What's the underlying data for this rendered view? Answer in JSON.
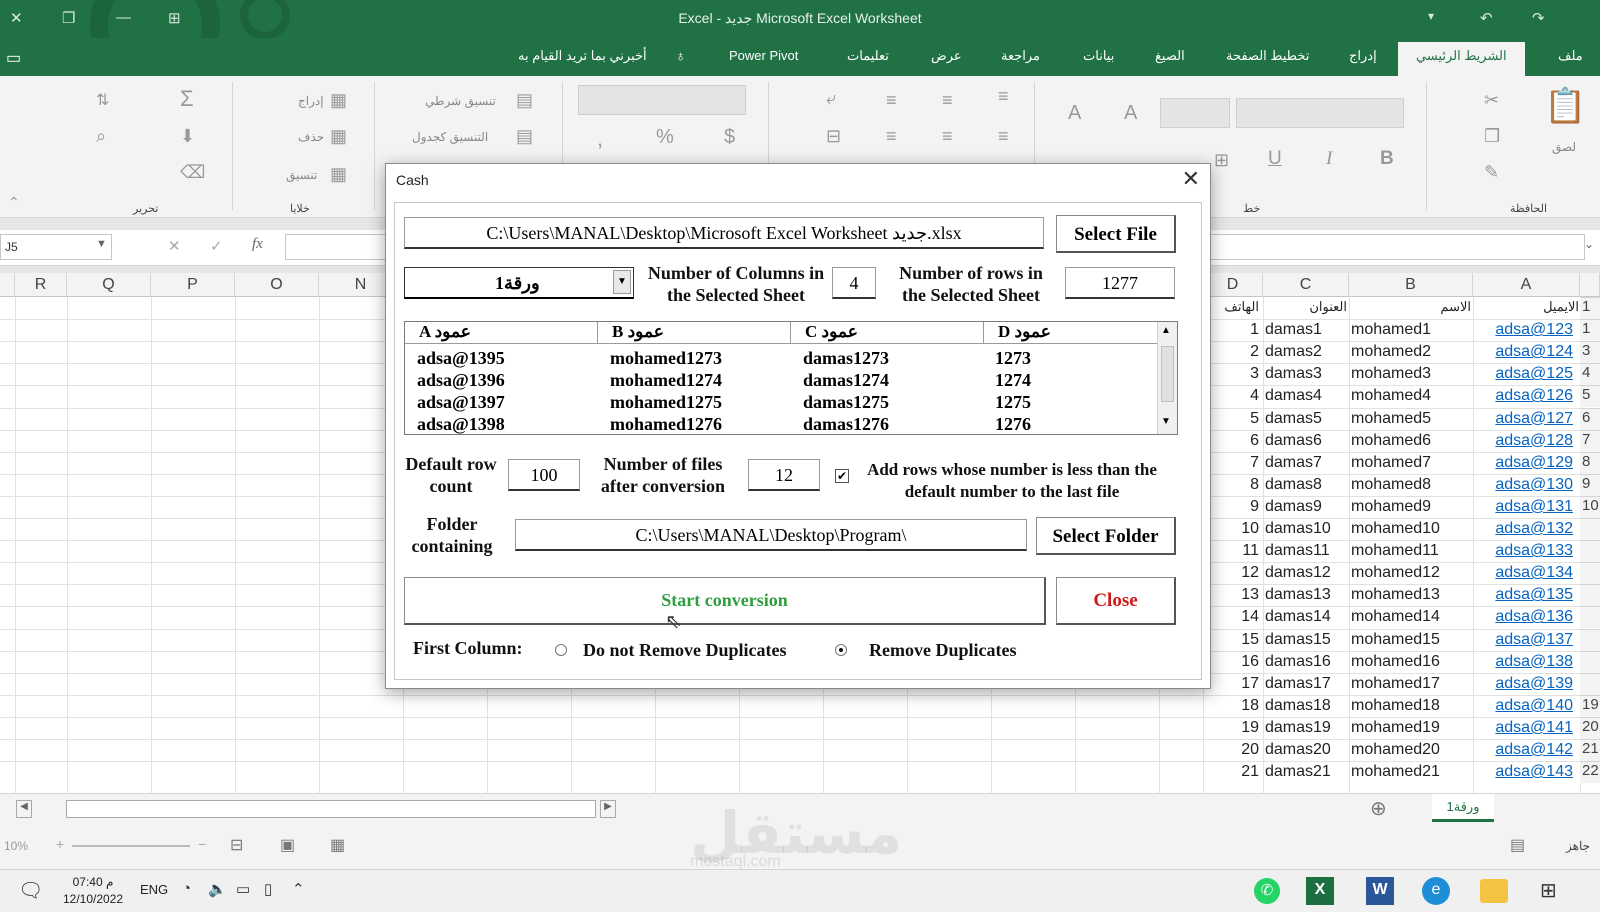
{
  "window": {
    "title": "Excel  -  جديد Microsoft Excel Worksheet"
  },
  "ribbon_tabs": [
    "ملف",
    "الشريط الرئيسي",
    "إدراج",
    "تخطيط الصفحة",
    "الصيغ",
    "بيانات",
    "مراجعة",
    "عرض",
    "تعليمات",
    "Power Pivot"
  ],
  "tell_me": "أخبرني بما تريد القيام به",
  "ribbon": {
    "groups": {
      "clipboard": "الحافظة",
      "font": "خط",
      "cells": "خلايا",
      "editing": "تحرير"
    },
    "cells_items": {
      "insert": "إدراج",
      "delete": "حذف",
      "format": "تنسيق"
    },
    "styles_items": {
      "conditional": "تنسيق شرطي",
      "as_table": "التنسيق كجدول"
    },
    "paste_label": "لصق",
    "number_symbols": {
      "currency": "$",
      "percent": "%",
      "comma": ","
    }
  },
  "formula_bar": {
    "name_box": "J5",
    "fx": "fx"
  },
  "sheet": {
    "left_columns": [
      "R",
      "Q",
      "P",
      "O",
      "N"
    ],
    "right_columns": [
      "D",
      "C",
      "B",
      "A"
    ],
    "headers": {
      "d": "الهاتف",
      "c": "العنوان",
      "b": "الاسم",
      "a": "الايميل"
    },
    "rows": [
      {
        "n": "1",
        "d": "1",
        "c": "damas1",
        "b": "mohamed1",
        "a": "adsa@123"
      },
      {
        "n": "3",
        "d": "2",
        "c": "damas2",
        "b": "mohamed2",
        "a": "adsa@124"
      },
      {
        "n": "4",
        "d": "3",
        "c": "damas3",
        "b": "mohamed3",
        "a": "adsa@125"
      },
      {
        "n": "5",
        "d": "4",
        "c": "damas4",
        "b": "mohamed4",
        "a": "adsa@126"
      },
      {
        "n": "6",
        "d": "5",
        "c": "damas5",
        "b": "mohamed5",
        "a": "adsa@127"
      },
      {
        "n": "7",
        "d": "6",
        "c": "damas6",
        "b": "mohamed6",
        "a": "adsa@128"
      },
      {
        "n": "8",
        "d": "7",
        "c": "damas7",
        "b": "mohamed7",
        "a": "adsa@129"
      },
      {
        "n": "9",
        "d": "8",
        "c": "damas8",
        "b": "mohamed8",
        "a": "adsa@130"
      },
      {
        "n": "10",
        "d": "9",
        "c": "damas9",
        "b": "mohamed9",
        "a": "adsa@131"
      },
      {
        "n": "",
        "d": "10",
        "c": "damas10",
        "b": "mohamed10",
        "a": "adsa@132"
      },
      {
        "n": "",
        "d": "11",
        "c": "damas11",
        "b": "mohamed11",
        "a": "adsa@133"
      },
      {
        "n": "",
        "d": "12",
        "c": "damas12",
        "b": "mohamed12",
        "a": "adsa@134"
      },
      {
        "n": "",
        "d": "13",
        "c": "damas13",
        "b": "mohamed13",
        "a": "adsa@135"
      },
      {
        "n": "",
        "d": "14",
        "c": "damas14",
        "b": "mohamed14",
        "a": "adsa@136"
      },
      {
        "n": "",
        "d": "15",
        "c": "damas15",
        "b": "mohamed15",
        "a": "adsa@137"
      },
      {
        "n": "",
        "d": "16",
        "c": "damas16",
        "b": "mohamed16",
        "a": "adsa@138"
      },
      {
        "n": "",
        "d": "17",
        "c": "damas17",
        "b": "mohamed17",
        "a": "adsa@139"
      },
      {
        "n": "19",
        "d": "18",
        "c": "damas18",
        "b": "mohamed18",
        "a": "adsa@140"
      },
      {
        "n": "20",
        "d": "19",
        "c": "damas19",
        "b": "mohamed19",
        "a": "adsa@141"
      },
      {
        "n": "21",
        "d": "20",
        "c": "damas20",
        "b": "mohamed20",
        "a": "adsa@142"
      },
      {
        "n": "22",
        "d": "21",
        "c": "damas21",
        "b": "mohamed21",
        "a": "adsa@143"
      }
    ],
    "sheet_tab": "ورقة1"
  },
  "status": {
    "ready": "جاهز",
    "zoom": "10%"
  },
  "taskbar": {
    "time": "07:40 م",
    "date": "12/10/2022",
    "lang": "ENG"
  },
  "watermark": {
    "text": "مستقل",
    "sub": "mostaql.com"
  },
  "dialog": {
    "title": "Cash",
    "file_path": "C:\\Users\\MANAL\\Desktop\\Microsoft Excel Worksheet جديد.xlsx",
    "select_file": "Select File",
    "sheet_select": "ورقة1",
    "num_columns_label": "Number of Columns in the Selected Sheet",
    "num_columns_value": "4",
    "num_rows_label": "Number of rows in the Selected Sheet",
    "num_rows_value": "1277",
    "list": {
      "headers": [
        "A عمود",
        "B عمود",
        "C عمود",
        "D عمود"
      ],
      "rows": [
        [
          "adsa@1395",
          "mohamed1273",
          "damas1273",
          "1273"
        ],
        [
          "adsa@1396",
          "mohamed1274",
          "damas1274",
          "1274"
        ],
        [
          "adsa@1397",
          "mohamed1275",
          "damas1275",
          "1275"
        ],
        [
          "adsa@1398",
          "mohamed1276",
          "damas1276",
          "1276"
        ]
      ]
    },
    "default_row_label": "Default row count",
    "default_row_value": "100",
    "files_after_label": "Number of files after conversion",
    "files_after_value": "12",
    "add_rows_label": "Add rows whose number is less than the default number to the last file",
    "add_rows_checked": true,
    "folder_label": "Folder containing",
    "folder_path": "C:\\Users\\MANAL\\Desktop\\Program\\",
    "select_folder": "Select Folder",
    "start": "Start conversion",
    "close": "Close",
    "first_column_label": "First Column:",
    "opt_no_remove": "Do not Remove Duplicates",
    "opt_remove": "Remove Duplicates",
    "selected_option": "remove",
    "colors": {
      "start": "#2e9e3e",
      "close": "#d01818"
    }
  }
}
